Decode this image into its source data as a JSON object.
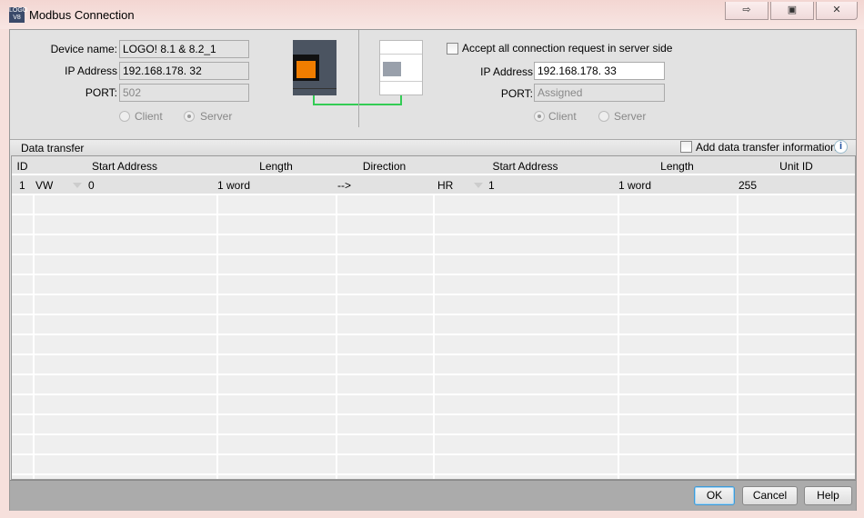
{
  "window": {
    "title": "Modbus Connection",
    "icon_text": "LOGO V8",
    "controls": [
      "pin-icon",
      "restore-icon",
      "close-icon"
    ]
  },
  "local": {
    "device_name_label": "Device name:",
    "device_name": "LOGO! 8.1 & 8.2_1",
    "ip_label": "IP Address",
    "ip": "192.168.178. 32",
    "port_label": "PORT:",
    "port": "502",
    "client_label": "Client",
    "server_label": "Server",
    "mode": "Server"
  },
  "remote": {
    "accept_label": "Accept all connection request in server side",
    "accept_checked": false,
    "ip_label": "IP Address",
    "ip": "192.168.178. 33",
    "port_label": "PORT:",
    "port": "Assigned",
    "client_label": "Client",
    "server_label": "Server",
    "mode": "Client"
  },
  "data_transfer": {
    "title": "Data transfer",
    "add_info_label": "Add data transfer information",
    "add_info_checked": false,
    "columns": [
      "ID",
      "Start Address",
      "Length",
      "Direction",
      "Start Address",
      "Length",
      "Unit ID"
    ],
    "rows": [
      {
        "id": "1",
        "local_area": "VW",
        "local_addr": "0",
        "local_length": "1 word",
        "direction": "-->",
        "remote_area": "HR",
        "remote_addr": "1",
        "remote_length": "1 word",
        "unit_id": "255"
      }
    ]
  },
  "buttons": {
    "ok": "OK",
    "cancel": "Cancel",
    "help": "Help"
  },
  "colors": {
    "link_line": "#33cc55",
    "device_orange": "#f07d00"
  }
}
